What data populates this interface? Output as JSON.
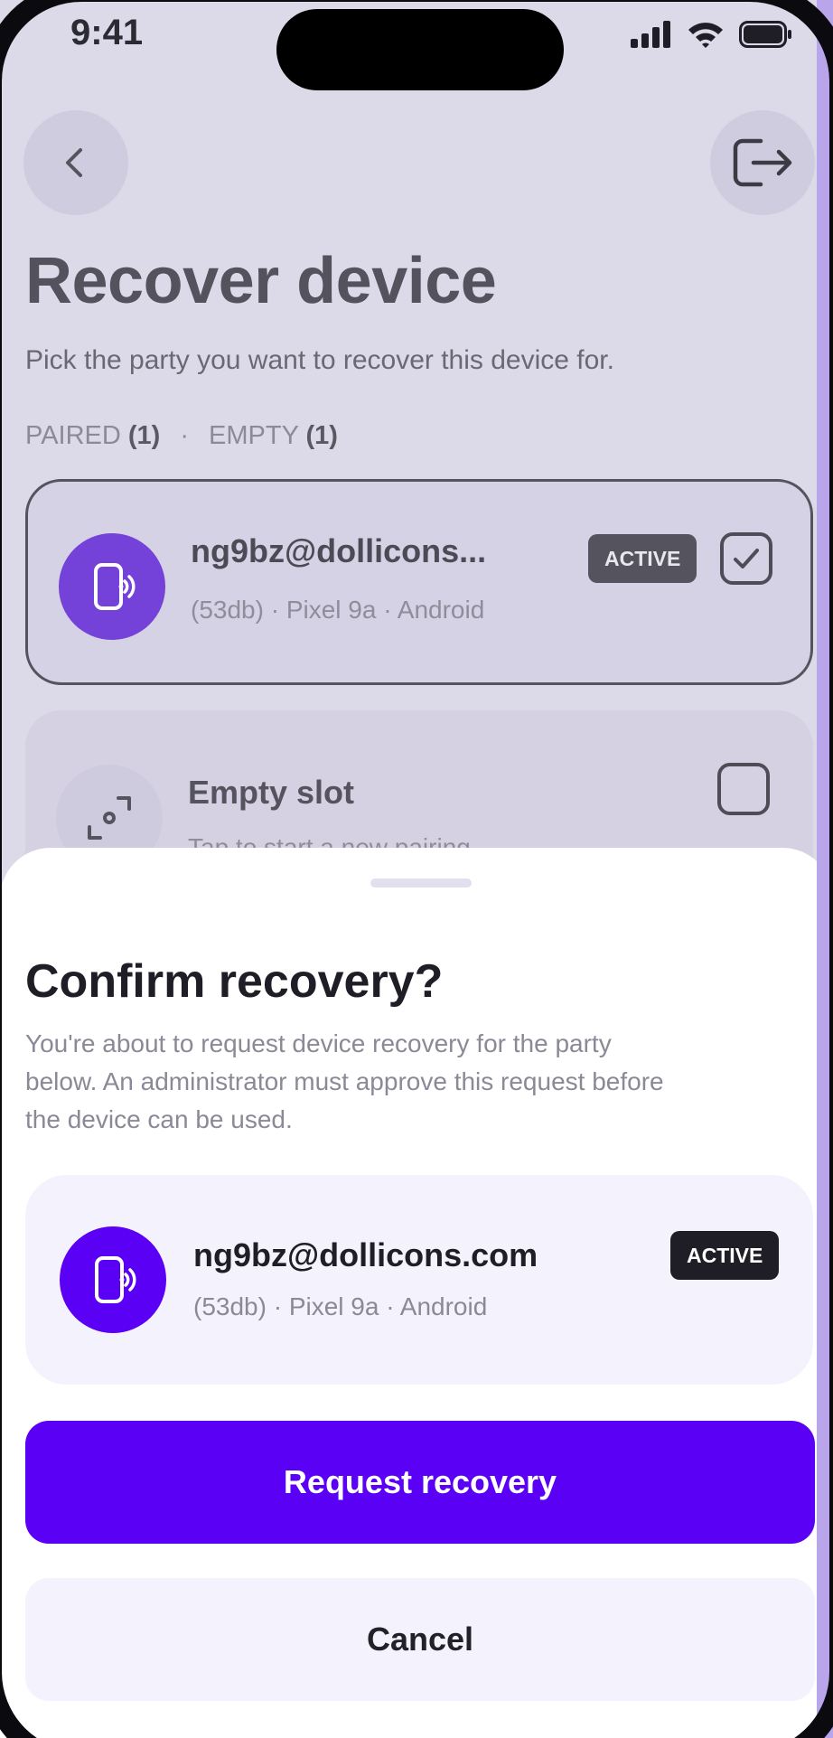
{
  "status_bar": {
    "time": "9:41"
  },
  "background": {
    "title": "Recover device",
    "subtitle": "Pick the party you want to recover this device for.",
    "filters": {
      "paired_label": "PAIRED",
      "paired_count": "(1)",
      "separator": "·",
      "empty_label": "EMPTY",
      "empty_count": "(1)"
    },
    "selected_party": {
      "name": "ng9bz@dollicons...",
      "meta": "(53db) · Pixel 9a · Android",
      "badge": "ACTIVE",
      "checked": true
    },
    "empty_slot": {
      "title": "Empty slot",
      "subtitle": "Tap to start a new pairing",
      "checked": false
    }
  },
  "sheet": {
    "title": "Confirm recovery?",
    "description": "You're about to request device recovery for the party below. An administrator must approve this request before the device can be used.",
    "party": {
      "name": "ng9bz@dollicons.com",
      "meta": "(53db) · Pixel 9a · Android",
      "badge": "ACTIVE"
    },
    "primary_button": "Request recovery",
    "secondary_button": "Cancel"
  },
  "colors": {
    "accent": "#5A00F5",
    "avatar_bg": "#5A00F5",
    "badge_bg": "#1F1E26",
    "overlay_tint": "#DCD9E8"
  },
  "icons": {
    "back": "chevron-left-icon",
    "logout": "logout-icon",
    "device": "phone-signal-icon",
    "scan": "scan-icon",
    "check": "check-icon"
  }
}
